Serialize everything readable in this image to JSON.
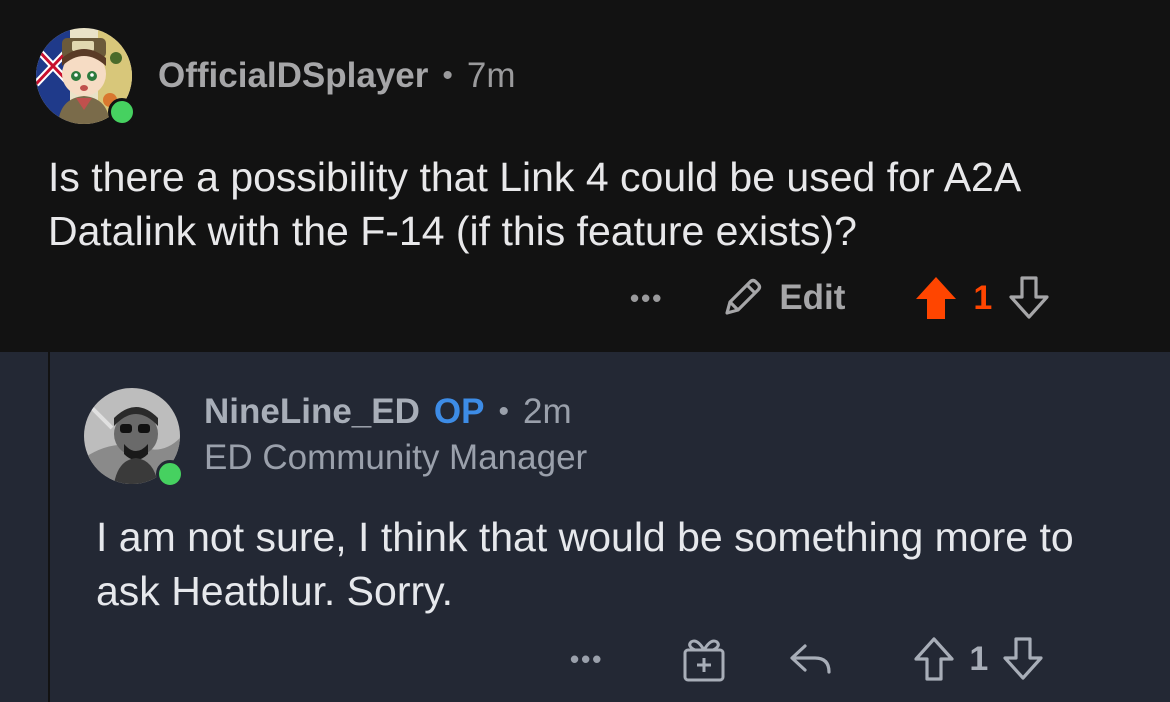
{
  "comments": [
    {
      "username": "OfficialDSplayer",
      "separator": "•",
      "time": "7m",
      "body": "Is there a possibility that Link 4 could be used for A2A Datalink with the F-14 (if this feature exists)?",
      "actions": {
        "more_label": "•••",
        "edit_label": "Edit",
        "vote_count": "1",
        "upvoted": true
      },
      "avatar": "anime-character-avatar",
      "online": true
    },
    {
      "username": "NineLine_ED",
      "op_badge": "OP",
      "separator": "•",
      "time": "2m",
      "flair": "ED Community Manager",
      "body": "I am not sure, I think that would be something more to ask Heatblur. Sorry.",
      "actions": {
        "more_label": "•••",
        "vote_count": "1",
        "upvoted": false
      },
      "avatar": "pilot-photo-avatar",
      "online": true
    }
  ],
  "colors": {
    "upvote_active": "#ff4500",
    "op_badge": "#3d8ce6",
    "online": "#46d160",
    "top_background": "#121212",
    "reply_background": "#232834"
  },
  "icons": [
    "more-icon",
    "pencil-icon",
    "upvote-arrow-icon",
    "downvote-arrow-icon",
    "award-gift-icon",
    "reply-icon"
  ]
}
